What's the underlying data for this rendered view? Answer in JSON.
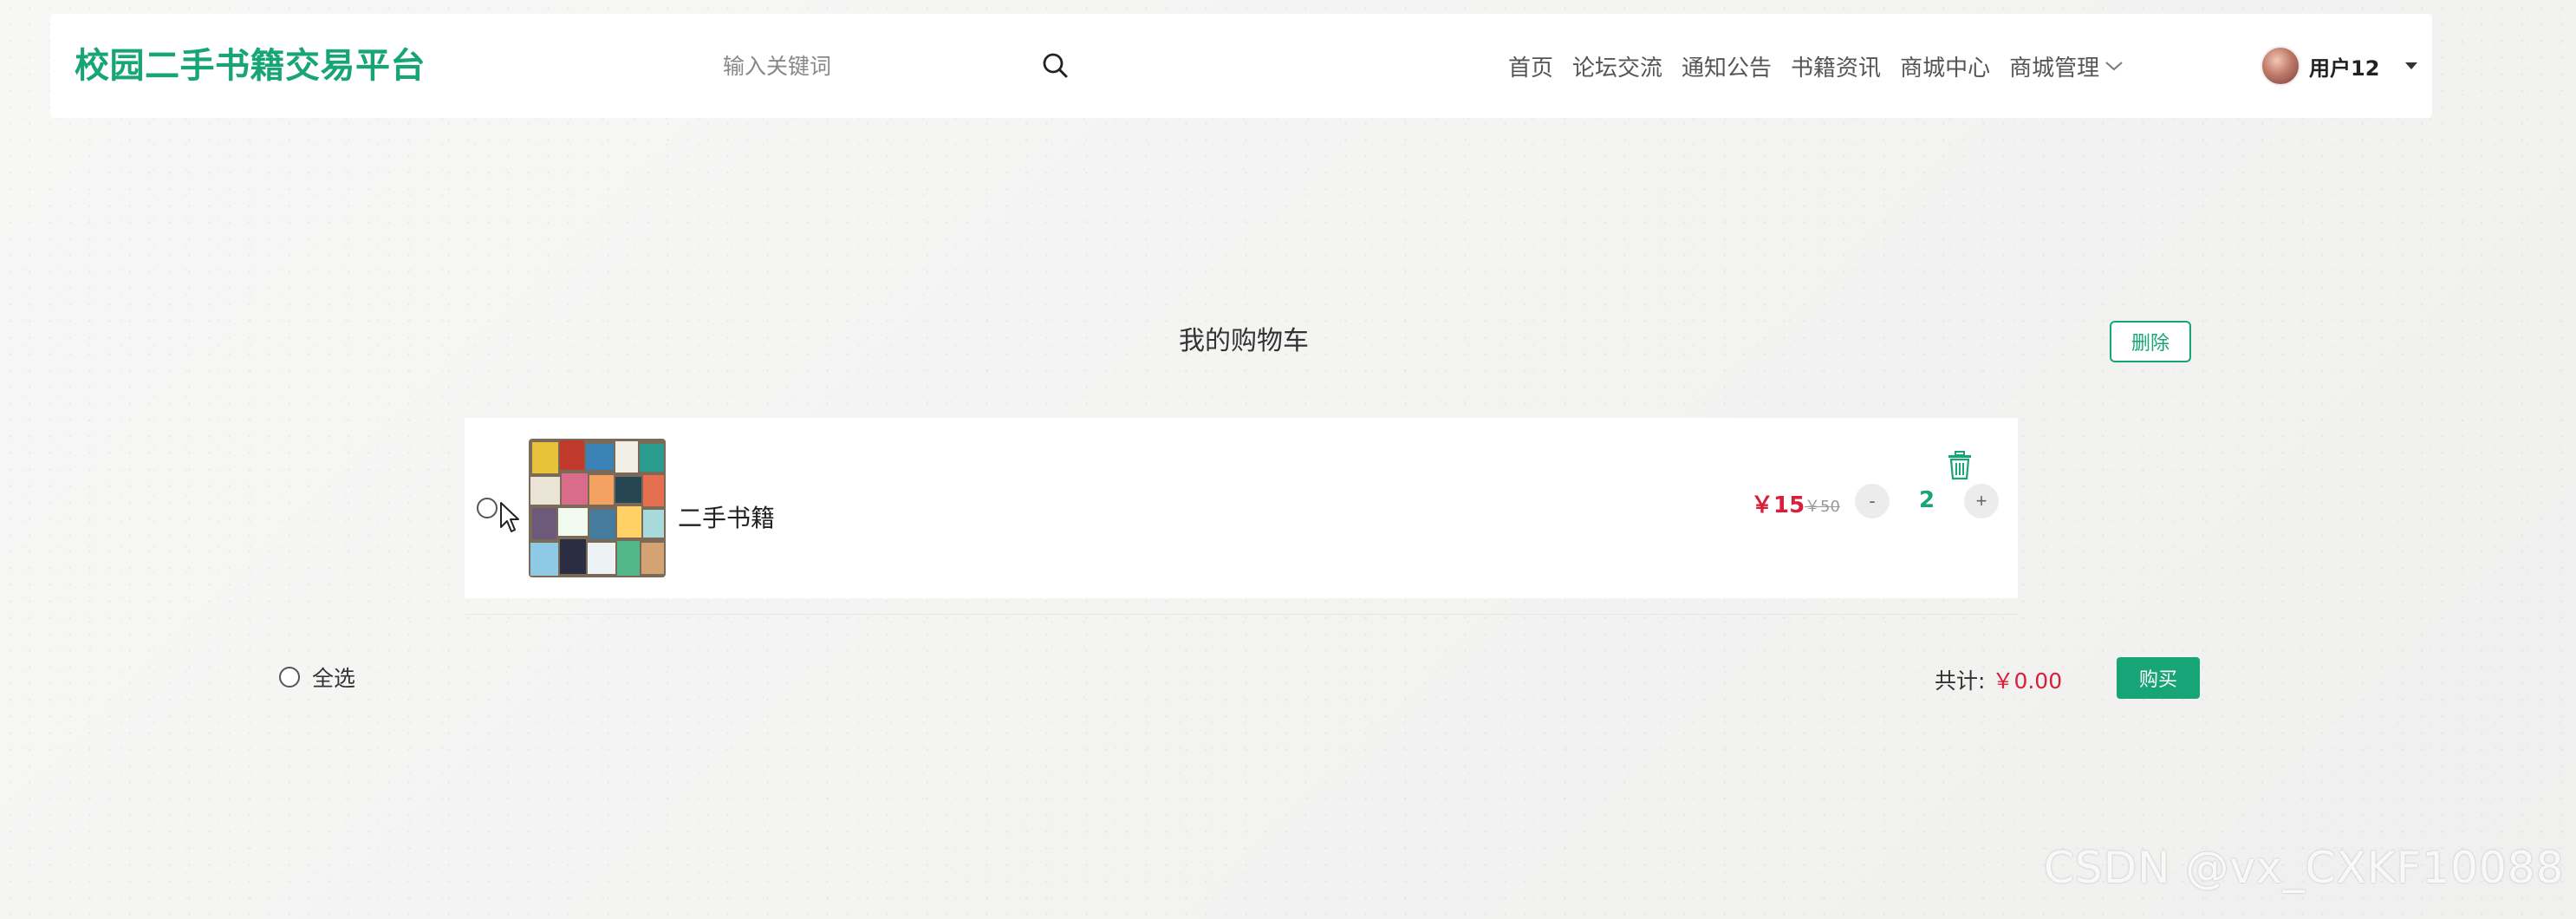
{
  "app": {
    "logo": "校园二手书籍交易平台"
  },
  "search": {
    "placeholder": "输入关键词",
    "icon": "search-icon"
  },
  "nav": {
    "items": [
      "首页",
      "论坛交流",
      "通知公告",
      "书籍资讯",
      "商城中心"
    ],
    "dropdown_label": "商城管理"
  },
  "user": {
    "name": "用户12"
  },
  "cart": {
    "title": "我的购物车",
    "delete_label": "删除",
    "items": [
      {
        "name": "二手书籍",
        "price": "￥15",
        "old_price": "￥50",
        "quantity": "2",
        "minus_label": "-",
        "plus_label": "+"
      }
    ],
    "select_all_label": "全选",
    "total_label": "共计:",
    "total_amount": "￥0.00",
    "buy_label": "购买"
  },
  "watermark": "CSDN @vx_CXKF10088",
  "colors": {
    "brand": "#17a476",
    "price": "#d81e3a",
    "background": "#f3f3f2"
  }
}
